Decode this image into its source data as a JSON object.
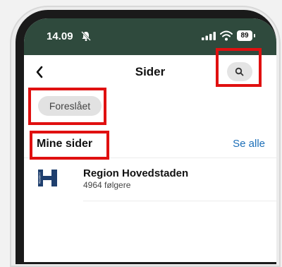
{
  "status_bar": {
    "time": "14.09",
    "battery_level": "89"
  },
  "header": {
    "title": "Sider"
  },
  "filters": {
    "suggested_label": "Foreslået"
  },
  "my_pages": {
    "section_title": "Mine sider",
    "see_all_label": "Se alle",
    "items": [
      {
        "name": "Region Hovedstaden",
        "followers": "4964 følgere",
        "logo_text": "REGION H"
      }
    ]
  },
  "colors": {
    "status_bar_bg": "#2f4a3d",
    "link": "#1d6fb8",
    "highlight": "#e01010",
    "logo": "#1f3f6e"
  }
}
